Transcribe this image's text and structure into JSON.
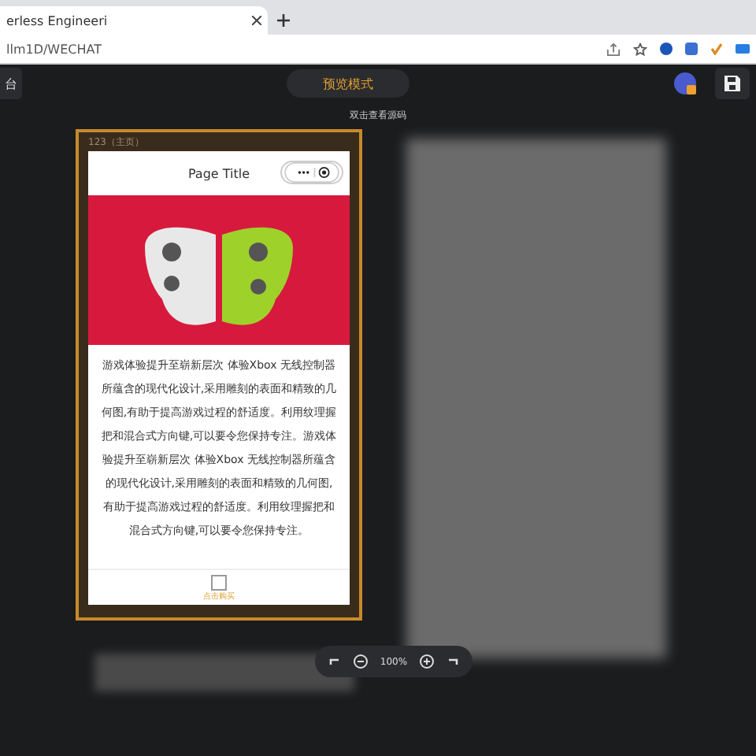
{
  "browser": {
    "tab_title": "erless Engineeri",
    "address": "llm1D/WECHAT"
  },
  "toolbar": {
    "left_button": "台",
    "mode_button": "预览模式",
    "hint": "双击查看源码"
  },
  "page_frame": {
    "label": "123（主页）",
    "page_title": "Page Title",
    "paragraph": "游戏体验提升至崭新层次 体验Xbox 无线控制器所蕴含的现代化设计,采用雕刻的表面和精致的几何图,有助于提高游戏过程的舒适度。利用纹理握把和混合式方向键,可以要令您保持专注。游戏体验提升至崭新层次 体验Xbox 无线控制器所蕴含的现代化设计,采用雕刻的表面和精致的几何图,有助于提高游戏过程的舒适度。利用纹理握把和混合式方向键,可以要令您保持专注。",
    "tab_label": "点击购买"
  },
  "zoom": {
    "value": "100%"
  }
}
